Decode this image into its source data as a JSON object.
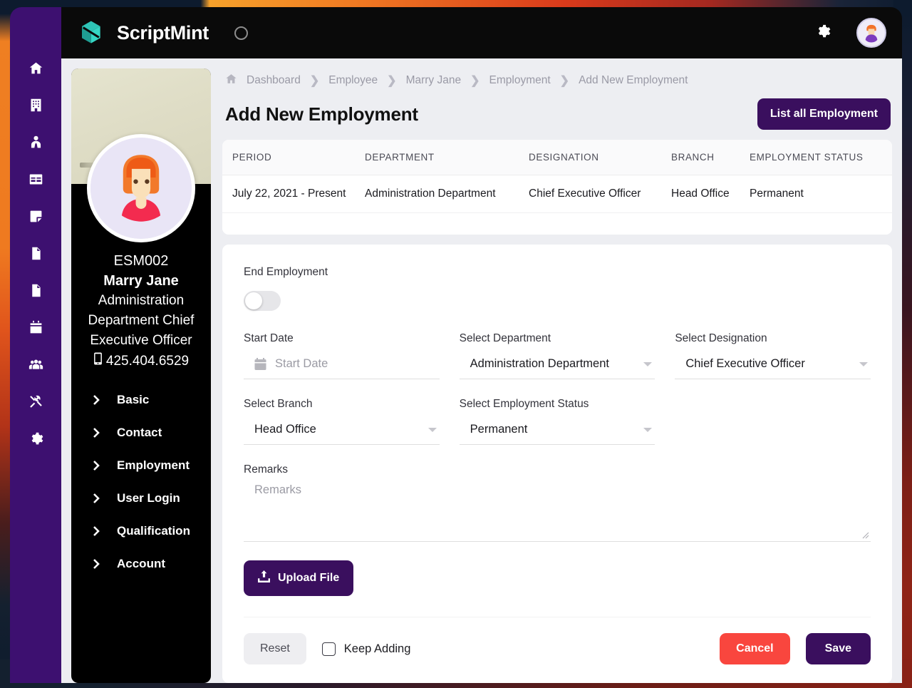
{
  "colors": {
    "brand_purple": "#3a0f5e",
    "rail_purple": "#3d1070",
    "topbar_black": "#0a0a0a",
    "cancel_red": "#f9463e",
    "logo_teal": "#2bb3a3",
    "page_bg": "#edeef2"
  },
  "topbar": {
    "brand": "ScriptMint",
    "logo_icon": "scriptmint-logo",
    "loader_icon": "loading-spinner-icon",
    "settings_icon": "gear-icon",
    "avatar_icon": "user-avatar"
  },
  "rail": {
    "items": [
      {
        "icon": "home-icon",
        "name": "dashboard"
      },
      {
        "icon": "building-icon",
        "name": "company"
      },
      {
        "icon": "user-tie-icon",
        "name": "employee"
      },
      {
        "icon": "table-icon",
        "name": "attendance"
      },
      {
        "icon": "sticky-note-icon",
        "name": "notes"
      },
      {
        "icon": "file-invoice-icon",
        "name": "payroll"
      },
      {
        "icon": "file-contract-icon",
        "name": "documents"
      },
      {
        "icon": "calendar-icon",
        "name": "leave"
      },
      {
        "icon": "users-icon",
        "name": "teams"
      },
      {
        "icon": "tools-icon",
        "name": "utilities"
      },
      {
        "icon": "gear-icon",
        "name": "settings"
      }
    ]
  },
  "profile": {
    "code": "ESM002",
    "name": "Marry Jane",
    "role": "Administration Department Chief Executive Officer",
    "phone": "425.404.6529",
    "phone_icon": "mobile-phone-icon",
    "nav": [
      {
        "label": "Basic"
      },
      {
        "label": "Contact"
      },
      {
        "label": "Employment"
      },
      {
        "label": "User Login"
      },
      {
        "label": "Qualification"
      },
      {
        "label": "Account"
      }
    ]
  },
  "breadcrumb": {
    "home_icon": "home-icon",
    "separator": "❯",
    "items": [
      {
        "label": "Dashboard"
      },
      {
        "label": "Employee"
      },
      {
        "label": "Marry Jane"
      },
      {
        "label": "Employment"
      },
      {
        "label": "Add New Employment"
      }
    ]
  },
  "page": {
    "title": "Add New Employment",
    "list_all_label": "List all Employment"
  },
  "table": {
    "headers": [
      "PERIOD",
      "DEPARTMENT",
      "DESIGNATION",
      "BRANCH",
      "EMPLOYMENT STATUS"
    ],
    "rows": [
      {
        "period": "July 22, 2021 - Present",
        "department": "Administration Department",
        "designation": "Chief Executive Officer",
        "branch": "Head Office",
        "status": "Permanent"
      }
    ]
  },
  "form": {
    "end_employment_label": "End Employment",
    "end_employment_on": false,
    "start_date": {
      "label": "Start Date",
      "value": "",
      "placeholder": "Start Date",
      "icon": "calendar-icon"
    },
    "department": {
      "label": "Select Department",
      "value": "Administration Department",
      "icon": "chevron-down-icon"
    },
    "designation": {
      "label": "Select Designation",
      "value": "Chief Executive Officer",
      "icon": "chevron-down-icon"
    },
    "branch": {
      "label": "Select Branch",
      "value": "Head Office",
      "icon": "chevron-down-icon"
    },
    "employment_status": {
      "label": "Select Employment Status",
      "value": "Permanent",
      "icon": "chevron-down-icon"
    },
    "remarks": {
      "label": "Remarks",
      "value": "",
      "placeholder": "Remarks"
    },
    "upload_label": "Upload File",
    "upload_icon": "upload-icon"
  },
  "footer": {
    "reset_label": "Reset",
    "keep_adding_label": "Keep Adding",
    "keep_adding_checked": false,
    "cancel_label": "Cancel",
    "save_label": "Save"
  }
}
